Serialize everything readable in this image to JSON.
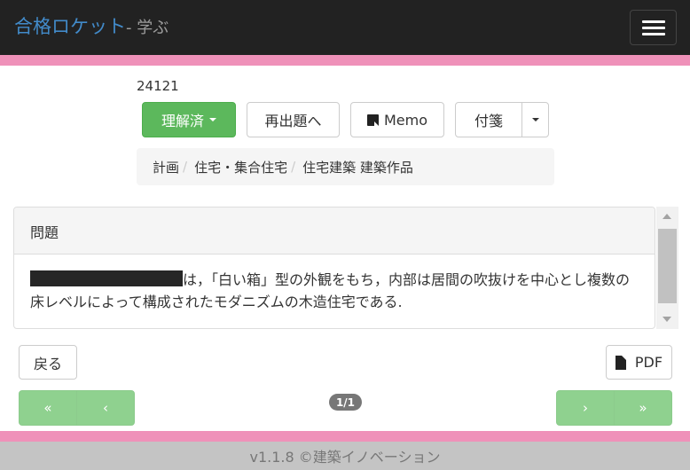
{
  "navbar": {
    "brand_main": "合格ロケット",
    "brand_sub": "- 学ぶ"
  },
  "question": {
    "id": "24121",
    "understood_label": "理解済",
    "review_label": "再出題へ",
    "memo_label": "Memo",
    "tag_label": "付箋"
  },
  "breadcrumb": {
    "items": [
      "計画",
      "住宅・集合住宅",
      "住宅建築 建築作品"
    ]
  },
  "panel": {
    "heading": "問題",
    "body": "は，「白い箱」型の外観をもち，内部は居間の吹抜けを中心とし複数の床レベルによって構成されたモダニズムの木造住宅である."
  },
  "actions": {
    "back_label": "戻る",
    "pdf_label": "PDF"
  },
  "pager": {
    "first": "«",
    "prev": "‹",
    "next": "›",
    "last": "»",
    "page": "1/1"
  },
  "footer": {
    "text": "v1.1.8 ©建築イノベーション"
  },
  "colors": {
    "navbar_bg": "#222222",
    "brand": "#428bca",
    "pink": "#ef91b9",
    "success": "#5cb85c",
    "pager": "#8fd18f"
  }
}
